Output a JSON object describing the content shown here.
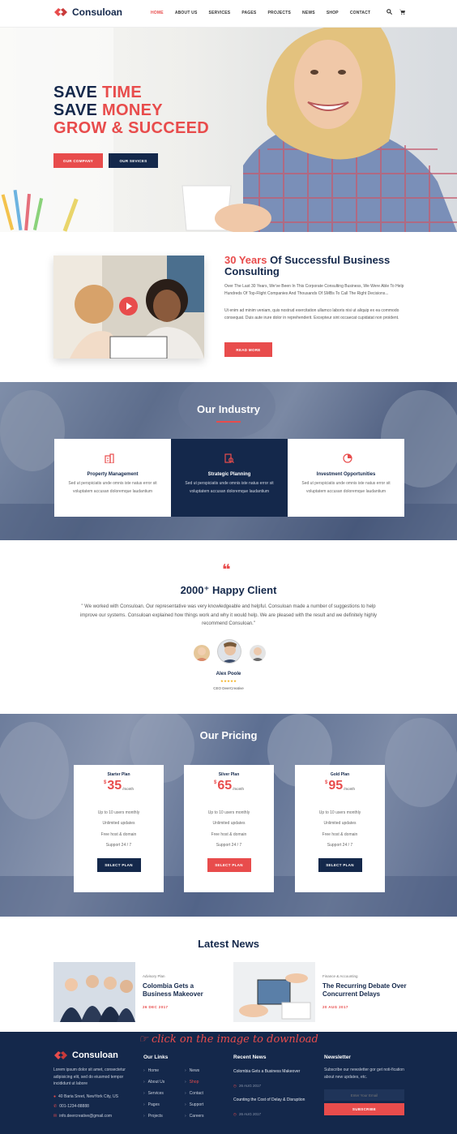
{
  "header": {
    "brand": "Consuloan",
    "nav": [
      "HOME",
      "ABOUT US",
      "SERVICES",
      "PAGES",
      "PROJECTS",
      "NEWS",
      "SHOP",
      "CONTACT"
    ],
    "active_nav": "HOME"
  },
  "hero": {
    "line1_a": "SAVE ",
    "line1_b": "TIME",
    "line2_a": "SAVE ",
    "line2_b": "MONEY",
    "line3": "GROW & SUCCEED",
    "btn_company": "OUR COMPANY",
    "btn_services": "OUR SEVICES"
  },
  "about": {
    "title_a": "30 Years",
    "title_b": " Of Successful Business Consulting",
    "para1": "Over The Last 30 Years, We've Been In This Corporate Consulting Business, We Were Able To Help Hundreds Of Top-Flight Companies And Thousands Of SMBs To Call The Right Decisions...",
    "para2": "Ut enim ad minim veniam, quis nostrud exercitation ullamco laboris nisi ut aliquip ex ea commodo consequat. Duis aute irure dolor in reprehenderit. Excepteur sint occaecat cupidatat non proident.",
    "btn": "READ MORE"
  },
  "industry": {
    "title": "Our Industry",
    "cards": [
      {
        "title": "Property Management",
        "desc": "Sed ut perspiciatis unde omnis iste natus error sit voluptatem accusan doloremque laudantium"
      },
      {
        "title": "Strategic Planning",
        "desc": "Sed ut perspiciatis unde omnis iste natus error sit voluptatem accusan doloremque laudantium"
      },
      {
        "title": "Investment Opportunities",
        "desc": "Sed ut perspiciatis unde omnis iste natus error sit voluptatem accusan doloremque laudantium"
      }
    ]
  },
  "testimonial": {
    "title": "2000⁺ Happy Client",
    "quote": "\" We worked with Consuloan. Our representative was  very knowledgeable and helpful. Consuloan made a number of suggestions to help improve our systems. Consuloan explained how things work and why it would help. We are pleased with the result and we definitely highly recommend Consuloan.\"",
    "name": "Alex Poole",
    "stars": "★★★★★",
    "role": "CEO DeerCreative"
  },
  "pricing": {
    "title": "Our Pricing",
    "plans": [
      {
        "name": "Starter Plan",
        "currency": "$",
        "amount": "35",
        "per": "/month",
        "f1": "Up to 10 users monthly",
        "f2": "Unlimited updates",
        "f3": "Free host & domain",
        "f4": "Support 24 / 7",
        "btn": "SELECT PLAN"
      },
      {
        "name": "Silver Plan",
        "currency": "$",
        "amount": "65",
        "per": "/month",
        "f1": "Up to 10 users monthly",
        "f2": "Unlimited updates",
        "f3": "Free host & domain",
        "f4": "Support 24 / 7",
        "btn": "SELECT PLAN"
      },
      {
        "name": "Gold Plan",
        "currency": "$",
        "amount": "95",
        "per": "/month",
        "f1": "Up to 10 users monthly",
        "f2": "Unlimited updates",
        "f3": "Free host & domain",
        "f4": "Support 24 / 7",
        "btn": "SELECT PLAN"
      }
    ]
  },
  "news": {
    "title": "Latest News",
    "items": [
      {
        "cat": "Advisory Plan",
        "title": "Colombia Gets a Business Makeover",
        "date": "26 DEC 2017"
      },
      {
        "cat": "Finance & Accounting",
        "title": "The Recurring Debate Over Concurrent Delays",
        "date": "20 AUG 2017"
      }
    ]
  },
  "banner": "click on the image to download",
  "footer": {
    "brand": "Consuloan",
    "about": "Lorem ipsum dolor sit amet, consectetur adipisicing elit, sed do eiusmod tempor incididunt ut labore",
    "address": "40 Baria Sreet, NewYork City, US",
    "phone": "001-1234-88888",
    "email": "info.deercreative@gmail.com",
    "links_title": "Our Links",
    "links_col1": [
      "Home",
      "About Us",
      "Services",
      "Pages",
      "Projects"
    ],
    "links_col2": [
      "News",
      "Shop",
      "Contact",
      "Support",
      "Careers"
    ],
    "recent_title": "Recent News",
    "recent": [
      {
        "title": "Colombia Gets a Business Makeover",
        "date": "26 AUG 2017"
      },
      {
        "title": "Counting the Cost of Delay & Disruption",
        "date": "26 AUG 2017"
      }
    ],
    "newsletter_title": "Newsletter",
    "newsletter_text": "Subscribe our newsletter gor get noti-fication about new updates, etc.",
    "email_placeholder": "Enter Your Email",
    "subscribe": "SUBSCRIBE"
  },
  "colors": {
    "navy": "#14284b",
    "accent": "#e84c4c",
    "footer_bg": "#14284b"
  }
}
